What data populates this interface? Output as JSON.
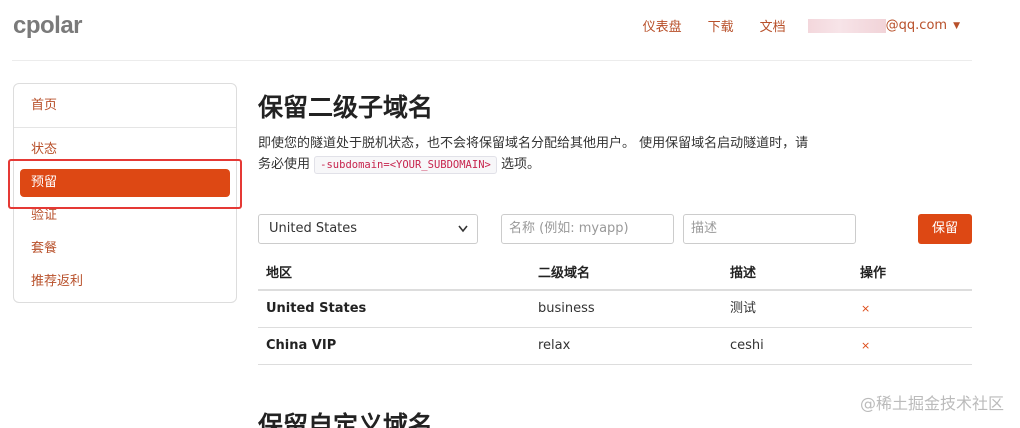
{
  "brand": {
    "logo": "cpolar"
  },
  "topnav": {
    "items": [
      "仪表盘",
      "下载",
      "文档"
    ],
    "user_suffix": "@qq.com",
    "caret": "▼"
  },
  "sidebar": {
    "items": [
      {
        "label": "首页"
      },
      {
        "label": "状态"
      },
      {
        "label": "预留"
      },
      {
        "label": "验证"
      },
      {
        "label": "套餐"
      },
      {
        "label": "推荐返利"
      }
    ],
    "active_index": 2
  },
  "page": {
    "title": "保留二级子域名",
    "desc_part1": "即使您的隧道处于脱机状态，也不会将保留域名分配给其他用户。 使用保留域名启动隧道时，请务必使用",
    "code": "-subdomain=<YOUR_SUBDOMAIN>",
    "desc_part2": "选项。"
  },
  "form": {
    "region_value": "United States",
    "name_placeholder": "名称 (例如: myapp)",
    "desc_placeholder": "描述",
    "submit_label": "保留"
  },
  "table": {
    "headers": [
      "地区",
      "二级域名",
      "描述",
      "操作"
    ],
    "rows": [
      {
        "region": "United States",
        "subdomain": "business",
        "desc": "测试",
        "action": "×"
      },
      {
        "region": "China VIP",
        "subdomain": "relax",
        "desc": "ceshi",
        "action": "×"
      }
    ]
  },
  "section2": {
    "title": "保留自定义域名"
  },
  "watermark": "@稀土掘金技术社区",
  "colors": {
    "accent": "#dd4814",
    "link": "#b8502a",
    "highlight_box": "#e53935"
  }
}
